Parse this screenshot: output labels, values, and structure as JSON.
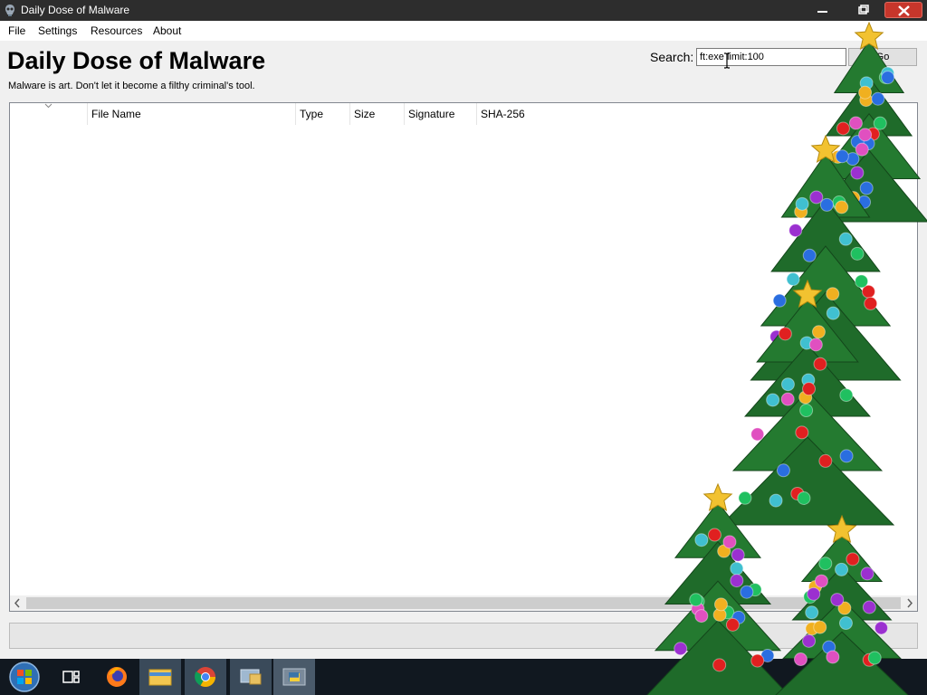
{
  "window": {
    "title": "Daily Dose of Malware"
  },
  "menu": {
    "items": [
      "File",
      "Settings",
      "Resources",
      "About"
    ]
  },
  "header": {
    "title": "Daily Dose of Malware",
    "subtitle": "Malware is art. Don't let it become a filthy criminal's tool."
  },
  "search": {
    "label": "Search:",
    "value": "ft:exe limit:100",
    "button": "Go"
  },
  "table": {
    "columns": [
      "File Name",
      "Type",
      "Size",
      "Signature",
      "SHA-256"
    ],
    "rows": []
  },
  "taskbar": {
    "items": [
      "start",
      "task-view",
      "firefox",
      "file-explorer",
      "chrome",
      "remote-desktop",
      "python"
    ]
  },
  "colors": {
    "titlebar": "#2d2d2d",
    "close": "#c7362b",
    "taskbar": "#111820"
  }
}
